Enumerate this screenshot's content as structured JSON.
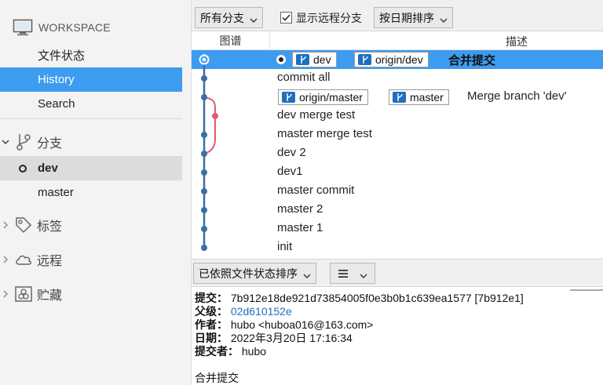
{
  "sidebar": {
    "workspace": "WORKSPACE",
    "items": [
      {
        "label": "文件状态"
      },
      {
        "label": "History"
      },
      {
        "label": "Search"
      }
    ],
    "branches_section": "分支",
    "branches": [
      {
        "label": "dev"
      },
      {
        "label": "master"
      }
    ],
    "tags_section": "标签",
    "remotes_section": "远程",
    "stash_section": "贮藏"
  },
  "toolbar": {
    "branch_filter": "所有分支",
    "show_remote": "显示远程分支",
    "sort": "按日期排序"
  },
  "list": {
    "graph_header": "图谱",
    "desc_header": "描述"
  },
  "commits": [
    {
      "refs": [
        "dev",
        "origin/dev"
      ],
      "message": "合并提交"
    },
    {
      "message": "commit all"
    },
    {
      "refs": [
        "origin/master",
        "master"
      ],
      "message": "Merge branch 'dev'"
    },
    {
      "message": "dev merge test"
    },
    {
      "message": "master merge test"
    },
    {
      "message": "dev 2"
    },
    {
      "message": "dev1"
    },
    {
      "message": "master commit"
    },
    {
      "message": "master 2"
    },
    {
      "message": "master 1"
    },
    {
      "message": "init"
    }
  ],
  "bottom_toolbar": {
    "sort_files": "已依照文件状态排序",
    "view_icon": "list-icon"
  },
  "detail": {
    "commit_label": "提交：",
    "commit_value": "7b912e18de921d73854005f0e3b0b1c639ea1577 [7b912e1]",
    "parent_label": "父级：",
    "parent_value": "02d610152e",
    "author_label": "作者：",
    "author_value": "hubo <huboa016@163.com>",
    "date_label": "日期：",
    "date_value": "2022年3月20日 17:16:34",
    "committer_label": "提交者：",
    "committer_value": "hubo",
    "message": "合并提交"
  },
  "colors": {
    "accent": "#3d9bf0",
    "graph_main": "#3a6ea5",
    "graph_branch": "#e35b6f"
  }
}
